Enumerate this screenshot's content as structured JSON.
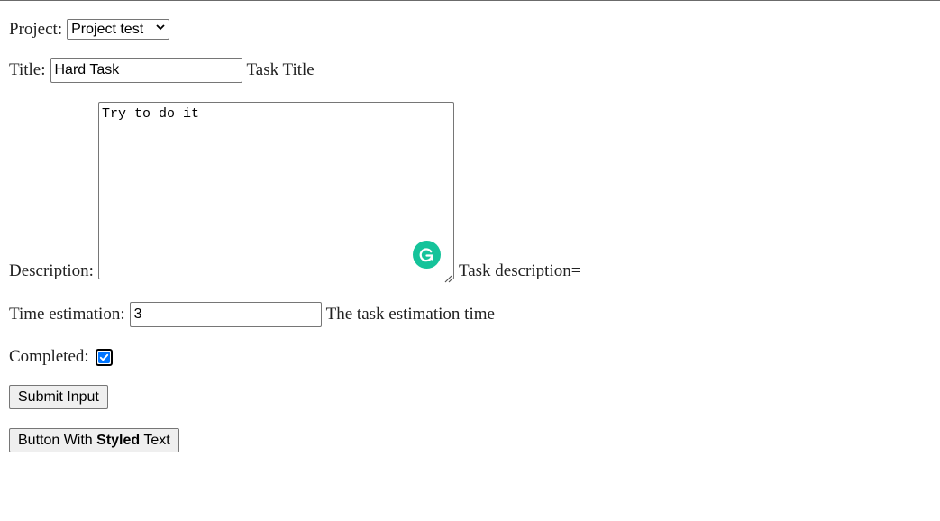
{
  "project": {
    "label": "Project:",
    "selected": "Project test"
  },
  "title_field": {
    "label": "Title:",
    "value": "Hard Task",
    "hint": "Task Title"
  },
  "description_field": {
    "label": "Description:",
    "value": "Try to do it",
    "hint": "Task description="
  },
  "time_field": {
    "label": "Time estimation:",
    "value": "3",
    "hint": "The task estimation time"
  },
  "completed_field": {
    "label": "Completed:",
    "checked": true
  },
  "submit_button": {
    "label": "Submit Input"
  },
  "styled_button": {
    "prefix": "Button With ",
    "bold": "Styled",
    "suffix": " Text"
  },
  "colors": {
    "grammarly_green": "#15c39a",
    "checkbox_blue": "#0075ff"
  },
  "icons": [
    "chevron-down-icon",
    "grammarly-icon",
    "resize-grip-icon",
    "checkmark-icon"
  ]
}
